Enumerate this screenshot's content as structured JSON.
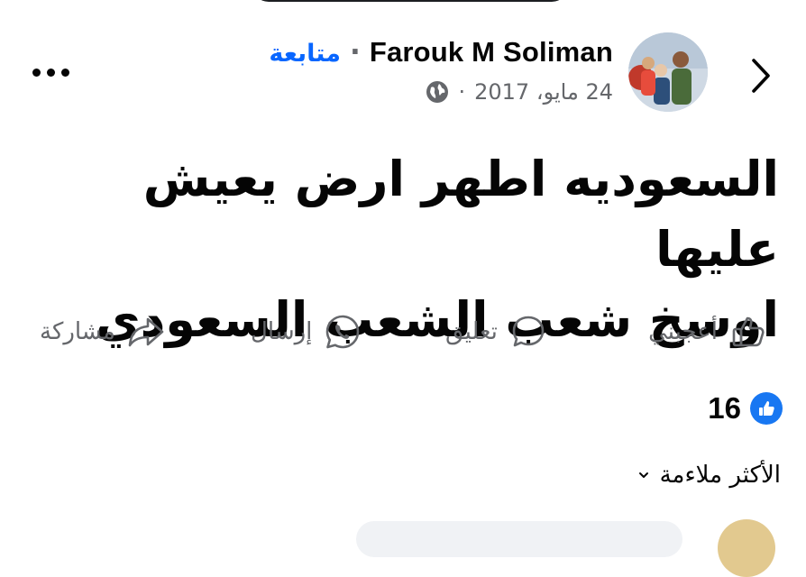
{
  "header": {
    "author_name": "Farouk M Soliman",
    "separator": "·",
    "follow_label": "متابعة",
    "date": "24 مايو، 2017",
    "date_separator": "·",
    "privacy_icon": "globe-icon",
    "back_icon": "chevron-right-icon",
    "more_icon": "more-horizontal-icon"
  },
  "post": {
    "lines": [
      "السعوديه اطهر ارض يعيش عليها",
      "اوسخ شعب الشعب السعودي"
    ]
  },
  "actions": {
    "like_label": "أعجبني",
    "comment_label": "تعليق",
    "send_label": "إرسال",
    "share_label": "مشاركة"
  },
  "reactions": {
    "count": "16"
  },
  "comments": {
    "sort_label": "الأكثر ملاءمة"
  },
  "colors": {
    "accent": "#0866ff",
    "like_badge": "#1877f2",
    "muted_text": "#65676b",
    "text": "#050505"
  }
}
